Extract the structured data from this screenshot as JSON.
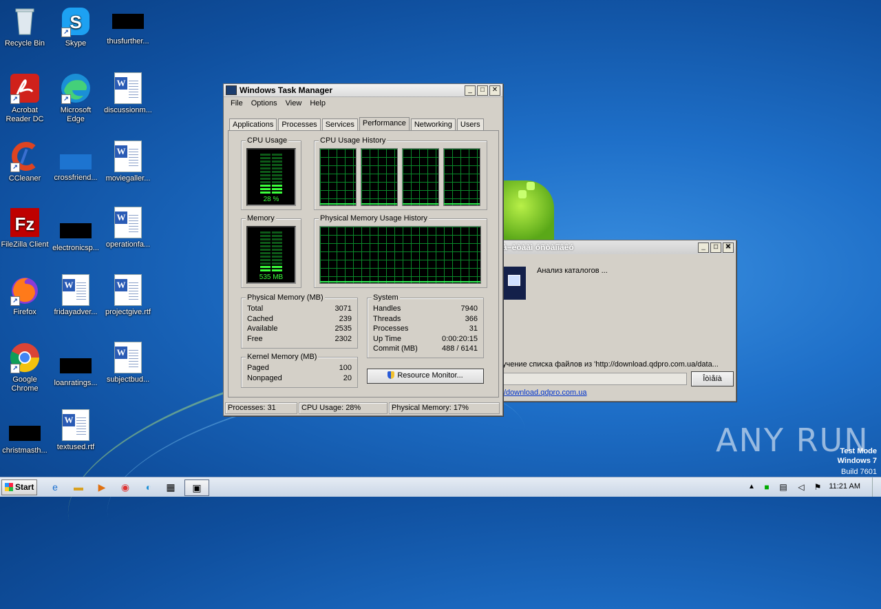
{
  "desktop": {
    "icons": [
      {
        "label": "Recycle Bin"
      },
      {
        "label": "Skype"
      },
      {
        "label": "thusfurther..."
      },
      {
        "label": "Acrobat Reader DC"
      },
      {
        "label": "Microsoft Edge"
      },
      {
        "label": "discussionm..."
      },
      {
        "label": "CCleaner"
      },
      {
        "label": "crossfriend..."
      },
      {
        "label": "moviegaller..."
      },
      {
        "label": "FileZilla Client"
      },
      {
        "label": "electronicsp..."
      },
      {
        "label": "operationfa..."
      },
      {
        "label": "Firefox"
      },
      {
        "label": "fridayadver..."
      },
      {
        "label": "projectgive.rtf"
      },
      {
        "label": "Google Chrome"
      },
      {
        "label": "loanratings..."
      },
      {
        "label": "subjectbud..."
      },
      {
        "label": "christmasth..."
      },
      {
        "label": "textused.rtf"
      }
    ]
  },
  "taskmgr": {
    "title": "Windows Task Manager",
    "menu": [
      "File",
      "Options",
      "View",
      "Help"
    ],
    "tabs": [
      "Applications",
      "Processes",
      "Services",
      "Performance",
      "Networking",
      "Users"
    ],
    "active_tab": "Performance",
    "cpu_usage_label": "CPU Usage",
    "cpu_usage_value": "28 %",
    "cpu_fraction": 0.28,
    "cpu_history_label": "CPU Usage History",
    "memory_label": "Memory",
    "memory_value": "535 MB",
    "memory_fraction": 0.17,
    "mem_history_label": "Physical Memory Usage History",
    "physical_memory": {
      "title": "Physical Memory (MB)",
      "rows": [
        {
          "k": "Total",
          "v": "3071"
        },
        {
          "k": "Cached",
          "v": "239"
        },
        {
          "k": "Available",
          "v": "2535"
        },
        {
          "k": "Free",
          "v": "2302"
        }
      ]
    },
    "kernel_memory": {
      "title": "Kernel Memory (MB)",
      "rows": [
        {
          "k": "Paged",
          "v": "100"
        },
        {
          "k": "Nonpaged",
          "v": "20"
        }
      ]
    },
    "system": {
      "title": "System",
      "rows": [
        {
          "k": "Handles",
          "v": "7940"
        },
        {
          "k": "Threads",
          "v": "366"
        },
        {
          "k": "Processes",
          "v": "31"
        },
        {
          "k": "Up Time",
          "v": "0:00:20:15"
        },
        {
          "k": "Commit (MB)",
          "v": "488 / 6141"
        }
      ]
    },
    "resource_monitor_button": "Resource Monitor...",
    "status": {
      "processes": "Processes: 31",
      "cpu": "CPU Usage: 28%",
      "memory": "Physical Memory: 17%"
    }
  },
  "dialog": {
    "title": "íà÷èìààò óñòàíîâêó",
    "title_visible": "à−èòààì óñòàíîâêó",
    "status": "Анализ каталогов ...",
    "progress_text": "учение списка файлов из 'http://download.qdpro.com.ua/data...",
    "cancel_button": "Îòìåíà",
    "link": "/download.qdpro.com.ua"
  },
  "watermark": {
    "brand": "ANY RUN",
    "line1": "Test Mode",
    "line2": "Windows 7",
    "line3": "Build 7601"
  },
  "taskbar": {
    "start_label": "Start",
    "clock": "11:21 AM"
  }
}
